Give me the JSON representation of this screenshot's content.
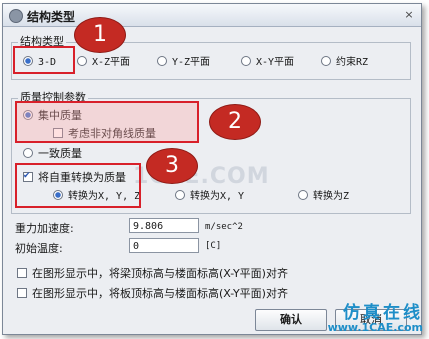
{
  "window": {
    "title": "结构类型",
    "close_label": "×"
  },
  "structure_type": {
    "group_label": "结构类型",
    "options": [
      {
        "label": "3-D",
        "selected": true
      },
      {
        "label": "X-Z平面",
        "selected": false
      },
      {
        "label": "Y-Z平面",
        "selected": false
      },
      {
        "label": "X-Y平面",
        "selected": false
      },
      {
        "label": "约束RZ",
        "selected": false
      }
    ]
  },
  "mass_control": {
    "group_label": "质量控制参数",
    "lumped_label": "集中质量",
    "lumped_selected": true,
    "offdiag_label": "考虑非对角线质量",
    "offdiag_checked": false,
    "consistent_label": "一致质量",
    "consistent_selected": false,
    "convert_label": "将自重转换为质量",
    "convert_checked": true,
    "convert_options": [
      {
        "label": "转换为X, Y, Z",
        "selected": true
      },
      {
        "label": "转换为X, Y",
        "selected": false
      },
      {
        "label": "转换为Z",
        "selected": false
      }
    ]
  },
  "gravity": {
    "label": "重力加速度:",
    "value": "9.806",
    "unit": "m/sec^2"
  },
  "initial_temp": {
    "label": "初始温度:",
    "value": "0",
    "unit": "[C]"
  },
  "align_options": [
    {
      "label": "在图形显示中，将梁顶标高与楼面标高(X-Y平面)对齐",
      "checked": false
    },
    {
      "label": "在图形显示中，将板顶标高与楼面标高(X-Y平面)对齐",
      "checked": false
    }
  ],
  "buttons": {
    "ok": "确认",
    "cancel": "取消"
  },
  "annotations": [
    "1",
    "2",
    "3"
  ],
  "watermark_text": "1CAE.COM",
  "brand": {
    "name": "仿真在线",
    "url": "www.1CAE.com"
  },
  "colors": {
    "highlight": "#d8202a",
    "badge": "#c42a23",
    "brand": "#1e8ec8"
  }
}
